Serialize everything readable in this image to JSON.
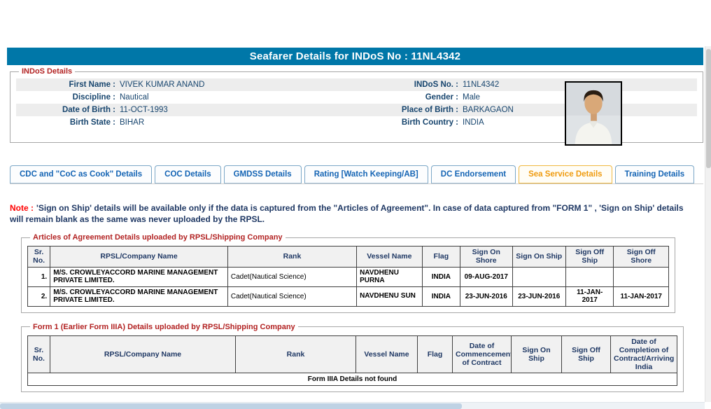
{
  "title_bar": {
    "title": "Seafarer Details for INDoS No : 11NL4342"
  },
  "colors": {
    "title_bar_bg": "#0077a8",
    "tab_text_blue": "#1464b4",
    "active_tab_orange": "#ef9b0f",
    "legend_maroon": "#b22222",
    "note_red": "#ff0000",
    "empty_message_red": "#cc0000"
  },
  "indos": {
    "legend": "INDoS Details",
    "rows": [
      {
        "l1": "First Name :",
        "v1": "VIVEK KUMAR ANAND",
        "l2": "INDoS No. :",
        "v2": "11NL4342"
      },
      {
        "l1": "Discipline :",
        "v1": "Nautical",
        "l2": "Gender :",
        "v2": "Male"
      },
      {
        "l1": "Date of Birth :",
        "v1": "11-OCT-1993",
        "l2": "Place of Birth :",
        "v2": "BARKAGAON"
      },
      {
        "l1": "Birth State :",
        "v1": "BIHAR",
        "l2": "Birth Country :",
        "v2": "INDIA"
      }
    ],
    "photo_alt": "seafarer-photo"
  },
  "tabs": [
    {
      "label": "CDC and \"CoC as Cook\" Details",
      "active": false
    },
    {
      "label": "COC Details",
      "active": false
    },
    {
      "label": "GMDSS Details",
      "active": false
    },
    {
      "label": "Rating [Watch Keeping/AB]",
      "active": false
    },
    {
      "label": "DC Endorsement",
      "active": false
    },
    {
      "label": "Sea Service Details",
      "active": true
    },
    {
      "label": "Training Details",
      "active": false
    }
  ],
  "note": {
    "prefix": "Note :",
    "text": "'Sign on Ship' details will be available only if the data is captured from the \"Articles of Agreement\". In case of data captured from \"FORM 1\" , 'Sign on Ship' details will remain blank as the same was never uploaded by the RPSL."
  },
  "articles": {
    "legend": "Articles of Agreement Details uploaded by RPSL/Shipping Company",
    "headers": [
      "Sr. No.",
      "RPSL/Company Name",
      "Rank",
      "Vessel Name",
      "Flag",
      "Sign On Shore",
      "Sign On Ship",
      "Sign Off Ship",
      "Sign Off Shore"
    ],
    "rows": [
      [
        "1.",
        "M/S. CROWLEYACCORD MARINE MANAGEMENT PRIVATE LIMITED.",
        "Cadet(Nautical Science)",
        "NAVDHENU PURNA",
        "INDIA",
        "09-AUG-2017",
        "",
        "",
        ""
      ],
      [
        "2.",
        "M/S. CROWLEYACCORD MARINE MANAGEMENT PRIVATE LIMITED.",
        "Cadet(Nautical Science)",
        "NAVDHENU SUN",
        "INDIA",
        "23-JUN-2016",
        "23-JUN-2016",
        "11-JAN-2017",
        "11-JAN-2017"
      ]
    ]
  },
  "form1": {
    "legend": "Form 1 (Earlier Form IIIA) Details uploaded by RPSL/Shipping Company",
    "headers": [
      "Sr. No.",
      "RPSL/Company Name",
      "Rank",
      "Vessel Name",
      "Flag",
      "Date of Commencement of Contract",
      "Sign On Ship",
      "Sign Off Ship",
      "Date of Completion of Contract/Arriving India"
    ],
    "empty_message": "Form IIIA Details not found"
  }
}
